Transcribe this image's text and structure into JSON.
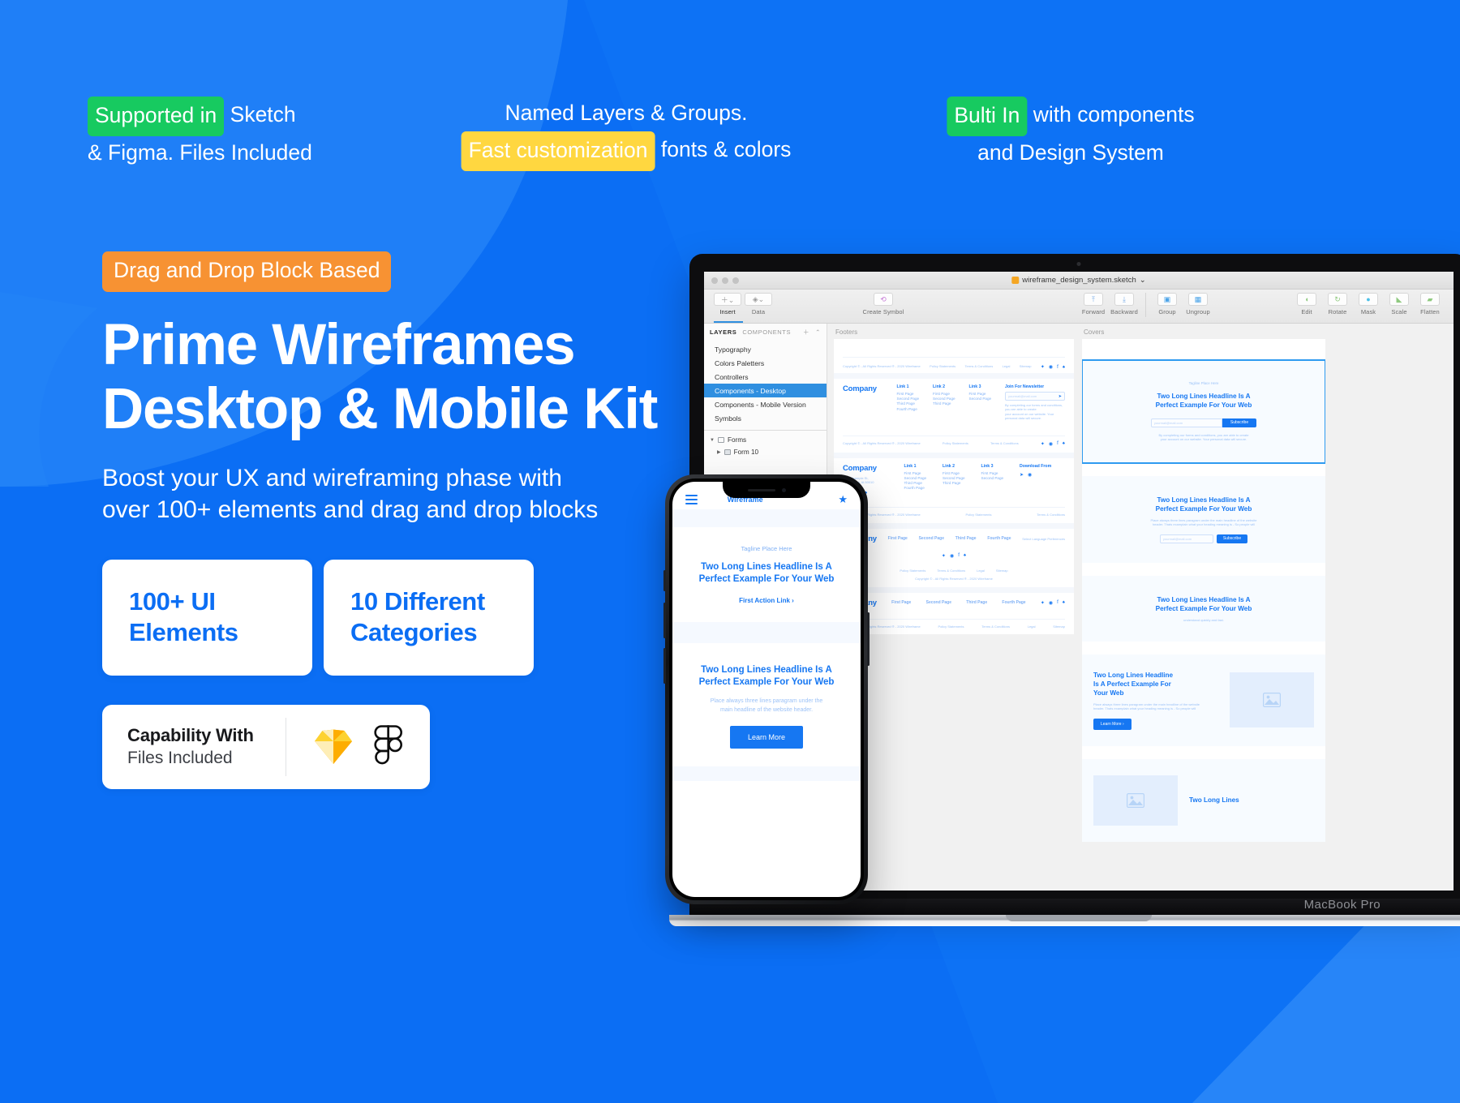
{
  "colors": {
    "background_blue": "#0b6ef4",
    "background_blue_light": "#2383f7",
    "pill_green": "#17CA60",
    "pill_yellow": "#FFD740",
    "pill_orange": "#F79233",
    "card_white": "#FFFFFF",
    "accent_blue_text": "#0b6ef4"
  },
  "top_features": [
    {
      "highlight": "Supported in",
      "highlight_color": "green",
      "rest_line1": " Sketch",
      "line2": "& Figma. Files Included"
    },
    {
      "line1": "Named Layers & Groups.",
      "highlight": "Fast customization",
      "highlight_color": "yellow",
      "rest_line2": " fonts & colors"
    },
    {
      "highlight": "Bulti In",
      "highlight_color": "green",
      "rest_line1": " with components",
      "line2": "and Design System"
    }
  ],
  "hero": {
    "badge": "Drag and Drop Block Based",
    "headline_line1": "Prime Wireframes",
    "headline_line2": "Desktop & Mobile Kit",
    "subhead_line1": "Boost your UX and wireframing phase with",
    "subhead_line2": "over 100+ elements and drag and drop blocks"
  },
  "stat_cards": [
    {
      "line1": "100+ UI",
      "line2": "Elements"
    },
    {
      "line1": "10 Different",
      "line2": "Categories"
    }
  ],
  "capability_card": {
    "title": "Capability With",
    "subtitle": "Files Included",
    "logos": [
      "sketch-logo",
      "figma-logo"
    ]
  },
  "laptop": {
    "model_label": "MacBook Pro",
    "app": {
      "filename": "wireframe_design_system.sketch",
      "toolbar_left": [
        {
          "label": "Insert",
          "icon": "plus-chevron",
          "active": true
        },
        {
          "label": "Data",
          "icon": "layers-chevron",
          "active": false
        }
      ],
      "toolbar_center": [
        {
          "label": "Create Symbol",
          "icon": "symbol-icon"
        }
      ],
      "toolbar_arrange": [
        {
          "label": "Forward",
          "icon": "forward-icon"
        },
        {
          "label": "Backward",
          "icon": "backward-icon"
        },
        {
          "label": "Group",
          "icon": "group-icon"
        },
        {
          "label": "Ungroup",
          "icon": "ungroup-icon"
        }
      ],
      "toolbar_right": [
        {
          "label": "Edit",
          "icon": "edit-icon"
        },
        {
          "label": "Rotate",
          "icon": "rotate-icon"
        },
        {
          "label": "Mask",
          "icon": "mask-icon"
        },
        {
          "label": "Scale",
          "icon": "scale-icon"
        },
        {
          "label": "Flatten",
          "icon": "flatten-icon"
        }
      ],
      "sidebar": {
        "tabs": [
          "LAYERS",
          "COMPONENTS"
        ],
        "active_tab": "LAYERS",
        "layers": [
          {
            "label": "Typography",
            "selected": false
          },
          {
            "label": "Colors Paletters",
            "selected": false
          },
          {
            "label": "Controllers",
            "selected": false
          },
          {
            "label": "Components - Desktop",
            "selected": true
          },
          {
            "label": "Components - Mobile Version",
            "selected": false
          },
          {
            "label": "Symbols",
            "selected": false
          }
        ],
        "tree": [
          {
            "label": "Forms",
            "icon": "artboard-icon",
            "expanded": true
          },
          {
            "label": "Form 10",
            "icon": "folder-icon",
            "expanded": false
          }
        ]
      },
      "canvas": {
        "artboards": [
          {
            "title": "Footers"
          },
          {
            "title": "Covers"
          }
        ],
        "wireframe_text": {
          "company": "Company",
          "company_typo": "Comapny",
          "links": [
            "Link 1",
            "Link 2",
            "Link 3"
          ],
          "pages": [
            "First Page",
            "Second Page",
            "Third Page",
            "Fourth Page"
          ],
          "newsletter_label": "Join For Newsletter",
          "newsletter_placeholder": "yourmail@mail.com",
          "download_label": "Download From",
          "legal": [
            "Policy Statements",
            "Terms & Conditions",
            "Legal",
            "Sitemap"
          ],
          "copyright": "Copyright © - All Rights Reserved ® - 2020 Wireframe",
          "lang_select": "Select Language Preferences",
          "address_l1": "9875 Example St,",
          "address_l2": "Nomadland, IA 50010",
          "cover_tagline": "Tagline Place Here",
          "cover_head_l1": "Two Long Lines Headline Is A",
          "cover_head_l2": "Perfect Example For Your Web",
          "cover_sub_l1": "Place always three lines paragram under the main headline of the website",
          "cover_sub_l2": "header. Thats examplain what your heading meaning is - So people will",
          "cover_sub_l3": "understand quickly and fast.",
          "subscribe": "Subscribe",
          "learn_more": "Learn More ›",
          "legal_note_l1": "By completing our forms and conditions, you are able to create",
          "legal_note_l2": "your account on our website. Your personal data will secure.",
          "long_lines": "Two Long Lines",
          "feature_head_l1": "Two Long Lines Headline",
          "feature_head_l2": "Is A Perfect Example For",
          "feature_head_l3": "Your Web"
        }
      }
    }
  },
  "phone": {
    "nav_brand": "Wireframe",
    "nav_menu_icon": "hamburger-icon",
    "nav_action_icon": "star-icon",
    "tagline": "Tagline Place Here",
    "headline_l1": "Two Long Lines Headline Is A",
    "headline_l2": "Perfect Example For Your Web",
    "action_link": "First Action Link ›",
    "section2_head_l1": "Two Long Lines Headline Is A",
    "section2_head_l2": "Perfect Example For Your Web",
    "section2_para_l1": "Place always three lines paragram under the",
    "section2_para_l2": "main headline of the website header.",
    "cta_button": "Learn More"
  }
}
